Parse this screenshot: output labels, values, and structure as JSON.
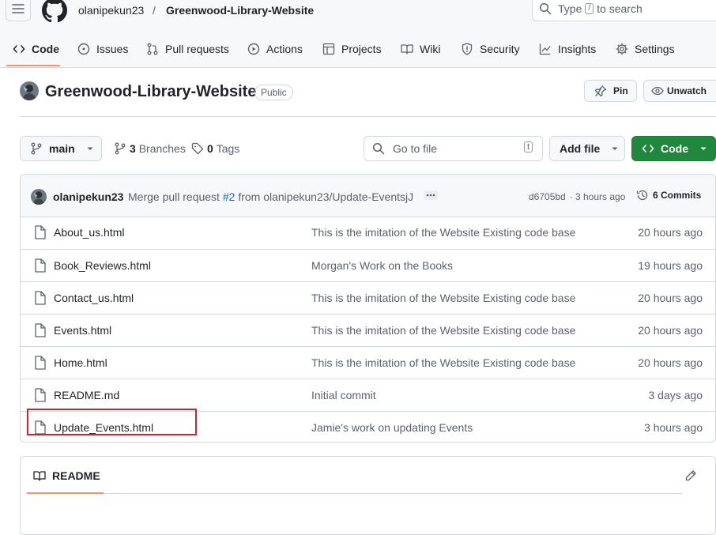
{
  "header": {
    "owner": "olanipekun23",
    "separator": "/",
    "repo": "Greenwood-Library-Website",
    "search_placeholder_before": "Type",
    "search_key": "/",
    "search_placeholder_after": "to search"
  },
  "tabs": [
    {
      "label": "Code",
      "icon": "code-icon",
      "selected": true
    },
    {
      "label": "Issues",
      "icon": "issue-icon"
    },
    {
      "label": "Pull requests",
      "icon": "pull-request-icon"
    },
    {
      "label": "Actions",
      "icon": "play-icon"
    },
    {
      "label": "Projects",
      "icon": "table-icon"
    },
    {
      "label": "Wiki",
      "icon": "book-icon"
    },
    {
      "label": "Security",
      "icon": "shield-icon"
    },
    {
      "label": "Insights",
      "icon": "graph-icon"
    },
    {
      "label": "Settings",
      "icon": "gear-icon"
    }
  ],
  "repo": {
    "title": "Greenwood-Library-Website",
    "visibility": "Public",
    "pin_label": "Pin",
    "unwatch_label": "Unwatch"
  },
  "branch_bar": {
    "branch": "main",
    "branches_count": "3",
    "branches_label": "Branches",
    "tags_count": "0",
    "tags_label": "Tags",
    "goto_placeholder": "Go to file",
    "goto_key": "t",
    "add_file_label": "Add file",
    "code_label": "Code"
  },
  "latest_commit": {
    "author": "olanipekun23",
    "message_before": "Merge pull request",
    "pr_link": "#2",
    "message_after": "from olanipekun23/Update-EventsjJ",
    "sha": "d6705bd",
    "dot": "·",
    "time": "3 hours ago",
    "commits_count": "6 Commits"
  },
  "files": [
    {
      "name": "About_us.html",
      "message": "This is the imitation of the Website Existing code base",
      "date": "20 hours ago"
    },
    {
      "name": "Book_Reviews.html",
      "message": "Morgan's Work on the Books",
      "date": "19 hours ago"
    },
    {
      "name": "Contact_us.html",
      "message": "This is the imitation of the Website Existing code base",
      "date": "20 hours ago"
    },
    {
      "name": "Events.html",
      "message": "This is the imitation of the Website Existing code base",
      "date": "20 hours ago"
    },
    {
      "name": "Home.html",
      "message": "This is the imitation of the Website Existing code base",
      "date": "20 hours ago"
    },
    {
      "name": "README.md",
      "message": "Initial commit",
      "date": "3 days ago"
    },
    {
      "name": "Update_Events.html",
      "message": "Jamie's work on updating Events",
      "date": "3 hours ago"
    }
  ],
  "readme": {
    "tab_label": "README"
  },
  "colors": {
    "accent_green": "#1f883d",
    "tab_underline": "#fd8c73",
    "highlight_red": "#d0212c",
    "link_blue": "#0969da"
  }
}
